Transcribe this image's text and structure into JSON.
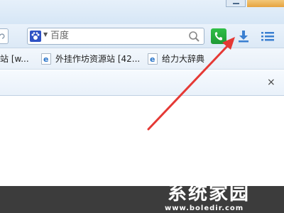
{
  "toolbar": {
    "search": {
      "engine_icon": "baidu-paw-icon",
      "placeholder": "百度",
      "search_icon": "search-icon"
    },
    "buttons": [
      {
        "name": "phone-button",
        "icon": "phone-icon",
        "color": "#27ae3f"
      },
      {
        "name": "download-button",
        "icon": "download-icon",
        "color": "#3a7fd1"
      },
      {
        "name": "menu-button",
        "icon": "menu-icon",
        "color": "#3a7fd1"
      }
    ]
  },
  "bookmarks": [
    {
      "label": "站 [w..."
    },
    {
      "label": "外挂作坊资源站 [42..."
    },
    {
      "label": "给力大辞典"
    }
  ],
  "tab_strip": {
    "close_label": "×"
  },
  "annotation": {
    "type": "red-arrow",
    "color": "#e53935",
    "target": "download-button"
  },
  "watermark": {
    "title": "系统家园",
    "url": "www.boledir.com"
  }
}
